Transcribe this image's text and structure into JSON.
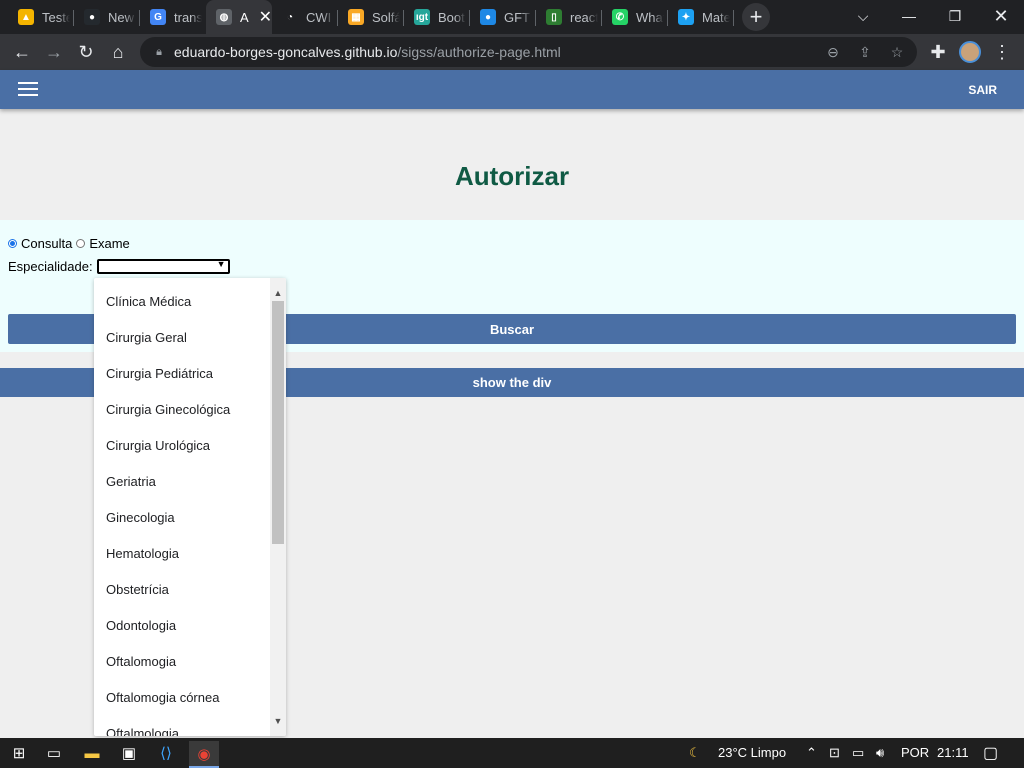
{
  "browser": {
    "tabs": [
      {
        "title": "Teste",
        "fav_color": "#f4b400",
        "fav_glyph": "▲"
      },
      {
        "title": "New",
        "fav_color": "#24292e",
        "fav_glyph": "●"
      },
      {
        "title": "trans",
        "fav_color": "#4285f4",
        "fav_glyph": "G"
      },
      {
        "title": "A",
        "fav_color": "#5f6368",
        "fav_glyph": "◍"
      },
      {
        "title": "CWI C",
        "fav_color": "#202124",
        "fav_glyph": "◔"
      },
      {
        "title": "Solfá",
        "fav_color": "#f9a825",
        "fav_glyph": "▦"
      },
      {
        "title": "Boot",
        "fav_color": "#26a69a",
        "fav_glyph": "ıgt"
      },
      {
        "title": "GFT S",
        "fav_color": "#1e88e5",
        "fav_glyph": "●"
      },
      {
        "title": "react",
        "fav_color": "#2e7d32",
        "fav_glyph": "▯"
      },
      {
        "title": "What",
        "fav_color": "#25d366",
        "fav_glyph": "✆"
      },
      {
        "title": "Mate",
        "fav_color": "#1da1f2",
        "fav_glyph": "✦"
      }
    ],
    "url_host": "eduardo-borges-goncalves.github.io",
    "url_path": "/sigss/authorize-page.html"
  },
  "page": {
    "sair_label": "SAIR",
    "title": "Autorizar",
    "radio_consulta": "Consulta",
    "radio_exame": "Exame",
    "especialidade_label": "Especialidade:",
    "buscar_label": "Buscar",
    "show_div_label": "show the div"
  },
  "dropdown_options": [
    "Clínica Médica",
    "Cirurgia Geral",
    "Cirurgia Pediátrica",
    "Cirurgia Ginecológica",
    "Cirurgia Urológica",
    "Geriatria",
    "Ginecologia",
    "Hematologia",
    "Obstetrícia",
    "Odontologia",
    "Oftalomogia",
    "Oftalomogia córnea",
    "Oftalmologia"
  ],
  "taskbar": {
    "weather": "23°C  Limpo",
    "lang": "POR",
    "time": "21:11"
  }
}
